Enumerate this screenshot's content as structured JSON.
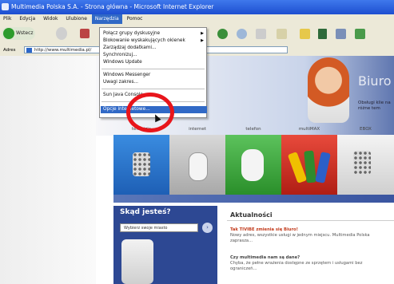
{
  "window": {
    "title": "Multimedia Polska S.A. - Strona główna - Microsoft Internet Explorer"
  },
  "menubar": {
    "items": [
      "Plik",
      "Edycja",
      "Widok",
      "Ulubione",
      "Narzędzia",
      "Pomoc"
    ],
    "active": "Narzędzia"
  },
  "toolbar": {
    "back_label": "Wstecz"
  },
  "address": {
    "label": "Adres",
    "url": "http://www.multimedia.pl/"
  },
  "tools_menu": {
    "items": [
      "Połącz grupy dyskusyjne",
      "Blokowanie wyskakujących okienek",
      "Zarządzaj dodatkami...",
      "Synchronizuj...",
      "Windows Update",
      "Windows Messenger",
      "Uwagi zakres...",
      "Sun Java Console",
      "Opcje internetowe..."
    ],
    "selected": "Opcje internetowe..."
  },
  "banner": {
    "headline": "Biuro O",
    "text": "Obsługi klie na różne tem"
  },
  "categories": [
    "telewizja",
    "internet",
    "telefon",
    "multiMAX",
    "EBOX"
  ],
  "category_colors": {
    "telewizja": "#1e6fd0",
    "internet": "#8a8a8a",
    "telefon": "#2aa52a",
    "multiMAX": "#d8281c",
    "EBOX": "#3c4f9f"
  },
  "sidebar": {
    "title": "Skąd jesteś?",
    "select_value": "Wybierz swoje miasto"
  },
  "news": {
    "title": "Aktualności",
    "item1_title": "Tak TIVIBE zmienia się Biuro!",
    "item1_text": "Nowy adres, wszystkie usługi w jednym miejscu. Multimedia Polska zaprasza...",
    "item2_title": "Czy multimedia nam są dane?",
    "item2_text": "Chyba, że pełne wrażenia dostępne ze sprzętem i usługami bez ograniczeń..."
  }
}
